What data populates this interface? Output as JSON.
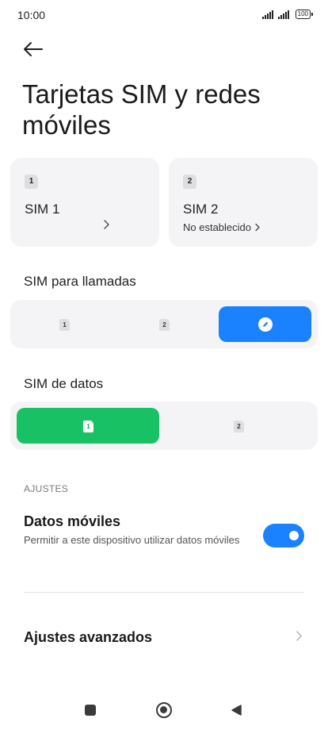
{
  "status_bar": {
    "time": "10:00",
    "battery": "100"
  },
  "header": {
    "title": "Tarjetas SIM y redes móviles"
  },
  "sim_cards": [
    {
      "chip": "1",
      "name": "SIM 1",
      "status": ""
    },
    {
      "chip": "2",
      "name": "SIM 2",
      "status": "No establecido"
    }
  ],
  "calls_section": {
    "label": "SIM para llamadas",
    "options": [
      {
        "chip": "1",
        "selected": false
      },
      {
        "chip": "2",
        "selected": false
      },
      {
        "icon": "edit-icon",
        "selected": true
      }
    ]
  },
  "data_section": {
    "label": "SIM de datos",
    "options": [
      {
        "chip": "1",
        "selected": true
      },
      {
        "chip": "2",
        "selected": false
      }
    ]
  },
  "settings": {
    "header": "AJUSTES",
    "mobile_data": {
      "title": "Datos móviles",
      "description": "Permitir a este dispositivo utilizar datos móviles",
      "enabled": true
    },
    "advanced": {
      "label": "Ajustes avanzados"
    }
  },
  "colors": {
    "accent_blue": "#1a82ff",
    "accent_green": "#17c164",
    "card_bg": "#f4f4f6"
  },
  "nav_bar": {
    "icons": [
      "recents-square-icon",
      "home-circle-icon",
      "back-triangle-icon"
    ]
  }
}
